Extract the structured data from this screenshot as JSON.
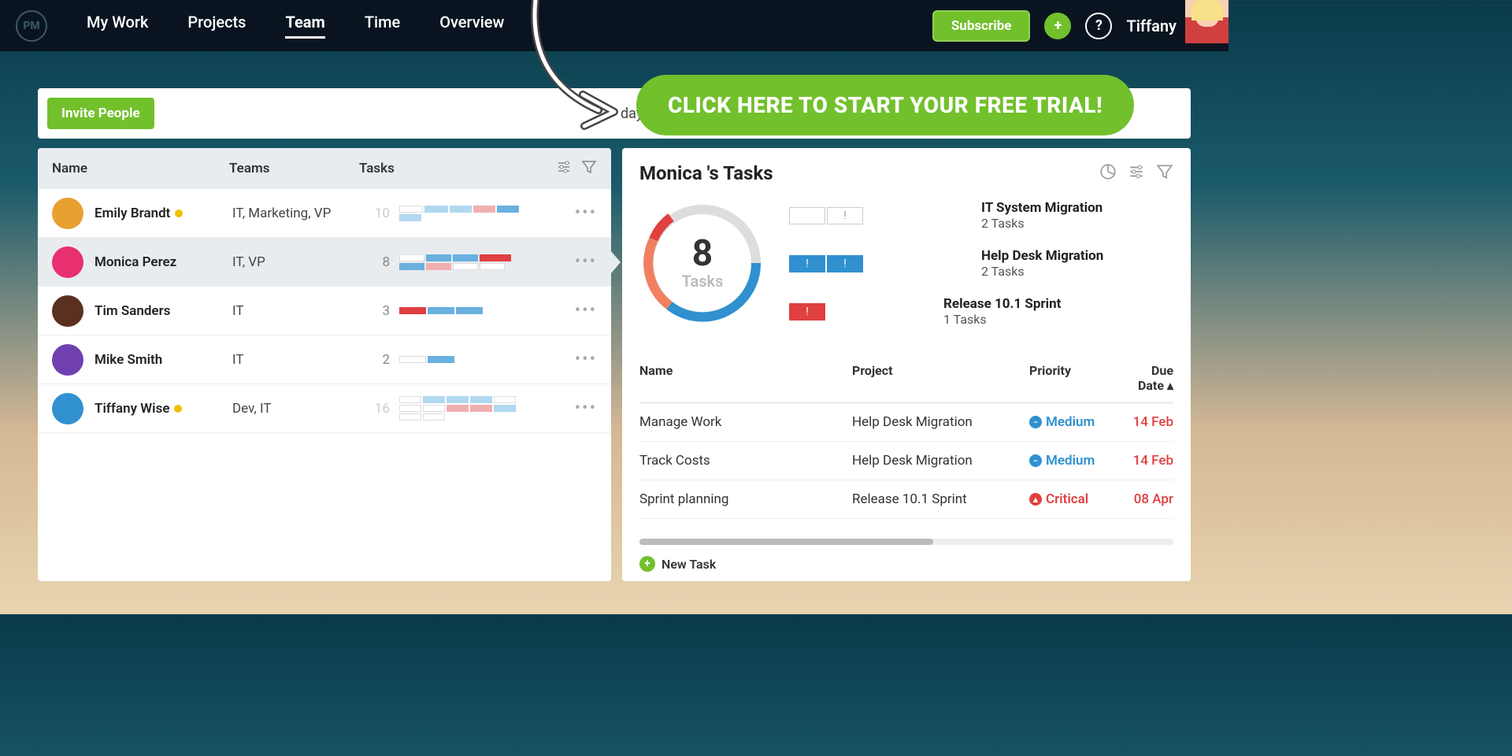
{
  "nav": {
    "logo": "PM",
    "items": [
      "My Work",
      "Projects",
      "Team",
      "Time",
      "Overview"
    ],
    "active_index": 2,
    "subscribe": "Subscribe",
    "user": "Tiffany"
  },
  "cta": "CLICK HERE TO START YOUR FREE TRIAL!",
  "toolbar": {
    "invite": "Invite People",
    "mid_text": "day"
  },
  "team_table": {
    "headers": {
      "name": "Name",
      "teams": "Teams",
      "tasks": "Tasks"
    },
    "rows": [
      {
        "name": "Emily Brandt",
        "dot": true,
        "teams": "IT, Marketing, VP",
        "count": "10",
        "light": true,
        "avatar": "av1"
      },
      {
        "name": "Monica Perez",
        "dot": false,
        "teams": "IT, VP",
        "count": "8",
        "light": false,
        "avatar": "av2",
        "selected": true
      },
      {
        "name": "Tim Sanders",
        "dot": false,
        "teams": "IT",
        "count": "3",
        "light": false,
        "avatar": "av3"
      },
      {
        "name": "Mike Smith",
        "dot": false,
        "teams": "IT",
        "count": "2",
        "light": false,
        "avatar": "av4"
      },
      {
        "name": "Tiffany Wise",
        "dot": true,
        "teams": "Dev, IT",
        "count": "16",
        "light": true,
        "avatar": "av5"
      }
    ]
  },
  "detail": {
    "title": "Monica 's Tasks",
    "donut": {
      "number": "8",
      "label": "Tasks"
    },
    "projects": [
      {
        "name": "IT System Migration",
        "tasks": "2 Tasks",
        "bars": [
          {
            "c": "white",
            "t": ""
          },
          {
            "c": "white",
            "t": "!"
          }
        ]
      },
      {
        "name": "Help Desk Migration",
        "tasks": "2 Tasks",
        "bars": [
          {
            "c": "blue",
            "t": "!"
          },
          {
            "c": "blue",
            "t": "!"
          }
        ]
      },
      {
        "name": "Release 10.1 Sprint",
        "tasks": "1 Tasks",
        "bars": [
          {
            "c": "red",
            "t": "!"
          }
        ]
      }
    ],
    "task_headers": {
      "name": "Name",
      "project": "Project",
      "priority": "Priority",
      "due": "Due Date"
    },
    "tasks": [
      {
        "name": "Manage Work",
        "project": "Help Desk Migration",
        "priority": "Medium",
        "pclass": "medium",
        "due": "14 Feb"
      },
      {
        "name": "Track Costs",
        "project": "Help Desk Migration",
        "priority": "Medium",
        "pclass": "medium",
        "due": "14 Feb"
      },
      {
        "name": "Sprint planning",
        "project": "Release 10.1 Sprint",
        "priority": "Critical",
        "pclass": "critical",
        "due": "08 Apr"
      }
    ],
    "new_task": "New Task"
  }
}
